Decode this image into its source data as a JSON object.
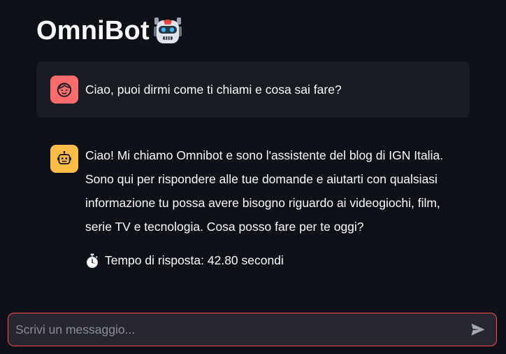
{
  "header": {
    "title": "OmniBot",
    "title_icon": "robot-face-icon"
  },
  "messages": {
    "user": {
      "avatar_icon": "user-face-icon",
      "avatar_color": "#ff6b6b",
      "text": "Ciao, puoi dirmi come ti chiami e cosa sai fare?"
    },
    "assistant": {
      "avatar_icon": "bot-icon",
      "avatar_color": "#ffbd45",
      "text": "Ciao! Mi chiamo Omnibot e sono l'assistente del blog di IGN Italia. Sono qui per rispondere alle tue domande e aiutarti con qualsiasi informazione tu possa avere bisogno riguardo ai videogiochi, film, serie TV e tecnologia. Cosa posso fare per te oggi?",
      "timing_icon": "stopwatch-icon",
      "timing_text": "Tempo di risposta: 42.80 secondi"
    }
  },
  "chat_input": {
    "placeholder": "Scrivi un messaggio...",
    "value": "",
    "send_icon": "send-icon",
    "border_color": "#ff4b4b"
  },
  "colors": {
    "background": "#0e1117",
    "user_bubble": "#1a1c24",
    "input_bg": "#262730"
  }
}
